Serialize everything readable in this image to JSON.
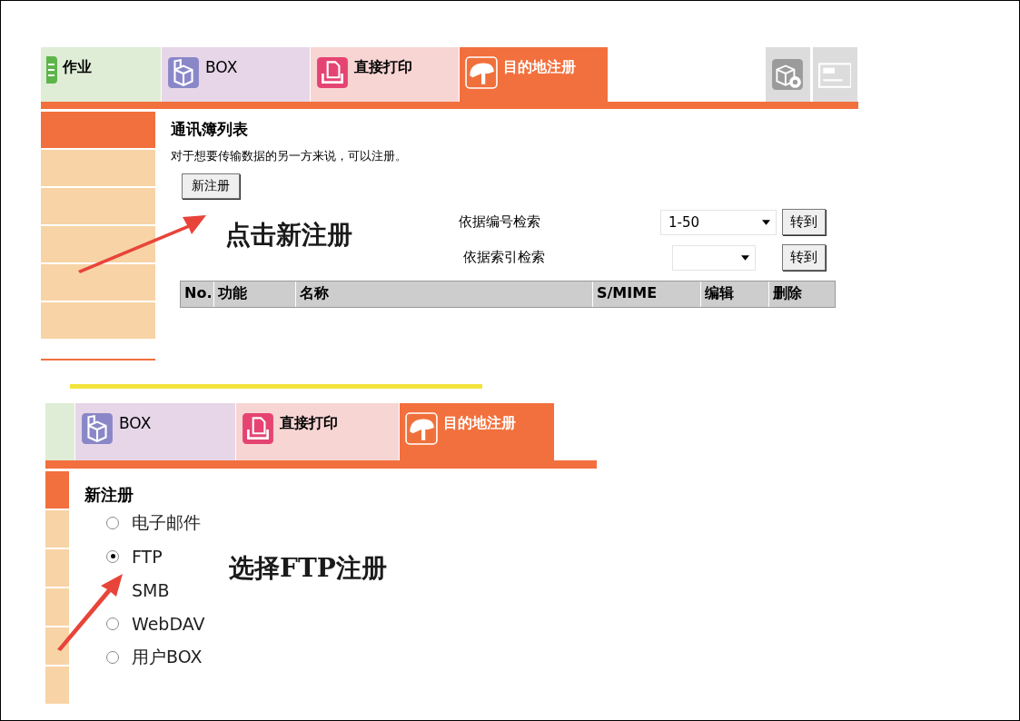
{
  "panels": [
    {
      "tabs": [
        {
          "kind": "job",
          "label": "作业",
          "selected": false
        },
        {
          "kind": "box",
          "label": "BOX",
          "selected": false
        },
        {
          "kind": "print",
          "label": "直接打印",
          "selected": false
        },
        {
          "kind": "dest",
          "label": "目的地注册",
          "selected": true
        },
        {
          "kind": "settings",
          "selected": false
        },
        {
          "kind": "device",
          "selected": false
        }
      ],
      "sidebar": [
        {
          "selected": true
        },
        {
          "selected": false
        },
        {
          "selected": false
        },
        {
          "selected": false
        },
        {
          "selected": false
        },
        {
          "selected": false
        }
      ],
      "kind": "list",
      "heading": "通讯簿列表",
      "description": "对于想要传输数据的另一方来说，可以注册。",
      "new_button": "新注册",
      "searches": [
        {
          "label": "依据编号检索",
          "value": "1-50",
          "button": "转到"
        },
        {
          "label": "依据索引检索",
          "button": "转到"
        }
      ],
      "columns": [
        "No.",
        "功能",
        "名称",
        "S/MIME",
        "编辑",
        "删除"
      ],
      "annotation": "点击新注册"
    },
    {
      "tabs": [
        {
          "kind": "job",
          "selected": false
        },
        {
          "kind": "box",
          "label": "BOX",
          "selected": false
        },
        {
          "kind": "print",
          "label": "直接打印",
          "selected": false
        },
        {
          "kind": "dest",
          "label": "目的地注册",
          "selected": true
        }
      ],
      "sidebar": [
        {
          "selected": true
        },
        {
          "selected": false
        },
        {
          "selected": false
        },
        {
          "selected": false
        },
        {
          "selected": false
        },
        {
          "selected": false
        }
      ],
      "kind": "form",
      "heading": "新注册",
      "options": [
        {
          "label": "电子邮件",
          "selected": false
        },
        {
          "label": "FTP",
          "selected": true
        },
        {
          "label": "SMB"
        },
        {
          "label": "WebDAV",
          "selected": false
        },
        {
          "label": "用户BOX",
          "selected": false
        }
      ],
      "annotation": "选择FTP注册"
    }
  ]
}
